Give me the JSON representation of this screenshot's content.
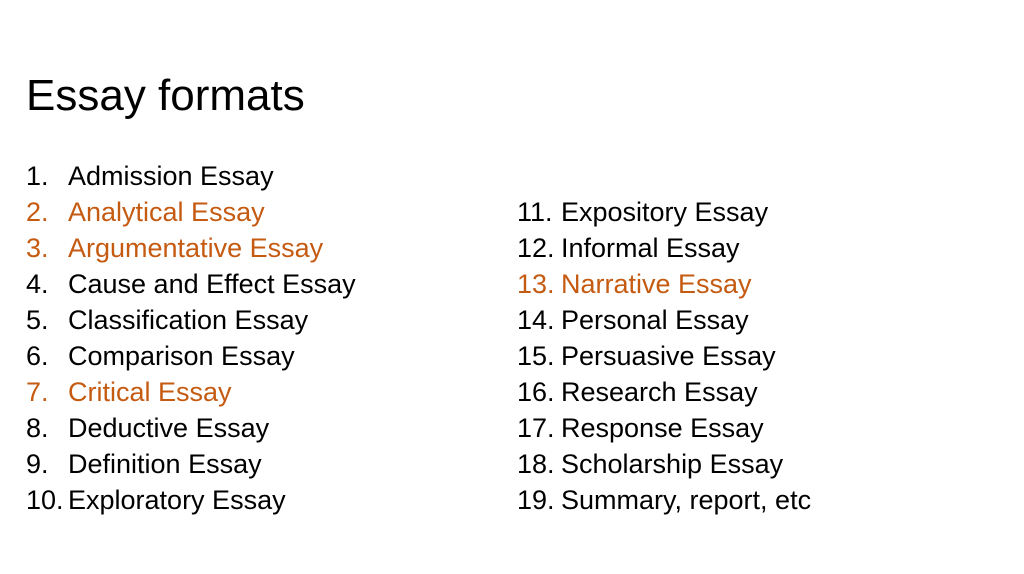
{
  "slide": {
    "title": "Essay formats",
    "highlight_color": "#C55A11",
    "columns": [
      {
        "items": [
          {
            "number": "1.",
            "label": "Admission Essay",
            "highlighted": false
          },
          {
            "number": "2.",
            "label": "Analytical Essay",
            "highlighted": true
          },
          {
            "number": "3.",
            "label": "Argumentative Essay",
            "highlighted": true
          },
          {
            "number": "4.",
            "label": "Cause and Effect Essay",
            "highlighted": false
          },
          {
            "number": "5.",
            "label": "Classification Essay",
            "highlighted": false
          },
          {
            "number": "6.",
            "label": "Comparison Essay",
            "highlighted": false
          },
          {
            "number": "7.",
            "label": "Critical Essay",
            "highlighted": true
          },
          {
            "number": "8.",
            "label": "Deductive Essay",
            "highlighted": false
          },
          {
            "number": "9.",
            "label": "Definition Essay",
            "highlighted": false
          },
          {
            "number": "10.",
            "label": "Exploratory Essay",
            "highlighted": false
          }
        ]
      },
      {
        "items": [
          {
            "number": "11.",
            "label": "Expository Essay",
            "highlighted": false
          },
          {
            "number": "12.",
            "label": "Informal Essay",
            "highlighted": false
          },
          {
            "number": "13.",
            "label": "Narrative Essay",
            "highlighted": true
          },
          {
            "number": "14.",
            "label": "Personal Essay",
            "highlighted": false
          },
          {
            "number": "15.",
            "label": "Persuasive Essay",
            "highlighted": false
          },
          {
            "number": "16.",
            "label": "Research Essay",
            "highlighted": false
          },
          {
            "number": "17.",
            "label": "Response Essay",
            "highlighted": false
          },
          {
            "number": "18.",
            "label": "Scholarship Essay",
            "highlighted": false
          },
          {
            "number": "19.",
            "label": "Summary, report, etc",
            "highlighted": false
          }
        ]
      }
    ]
  }
}
